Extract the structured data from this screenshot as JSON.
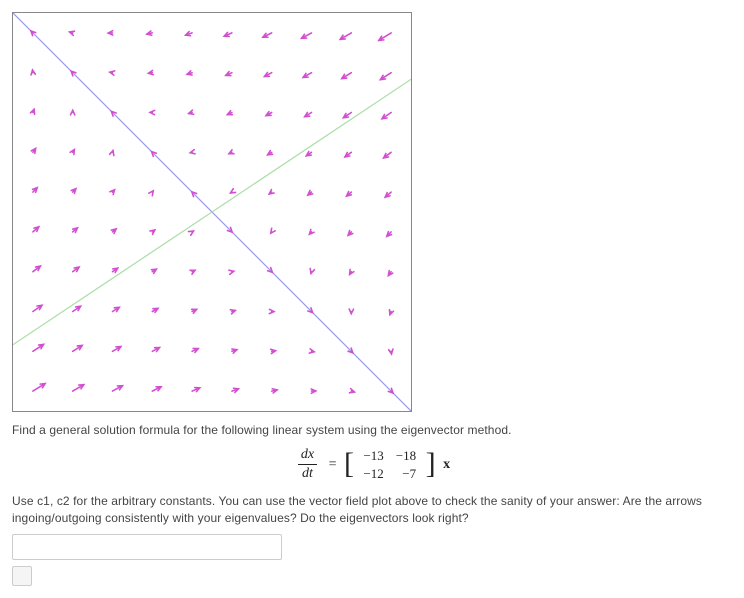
{
  "problem": {
    "prompt": "Find a general solution formula for the following linear system using the eigenvector method.",
    "equation": {
      "lhs_num": "dx",
      "lhs_den": "dt",
      "matrix": {
        "a11": "−13",
        "a12": "−18",
        "a21": "−12",
        "a22": "−7"
      },
      "vector": "x"
    },
    "hint": "Use c1, c2 for the arbitrary constants. You can use the vector field plot above to check the sanity of your answer: Are the arrows ingoing/outgoing consistently with your eigenvalues? Do the eigenvectors look right?"
  },
  "answer_value": "",
  "answer_placeholder": "",
  "chart_data": {
    "type": "vector-field",
    "title": "",
    "xlabel": "",
    "ylabel": "",
    "xlim": [
      -1,
      1
    ],
    "ylim": [
      -1,
      1
    ],
    "system_matrix": [
      [
        -13,
        -18
      ],
      [
        -12,
        -7
      ]
    ],
    "eigen_lines": [
      {
        "name": "eigenline-1",
        "slope": -1,
        "color": "#9a9ae8"
      },
      {
        "name": "eigenline-2",
        "slope": 0.6667,
        "color": "#a6dda6"
      }
    ],
    "grid_step": 0.2,
    "arrow_scale": 0.0022,
    "arrow_color": "#d24fd2",
    "annotations": []
  }
}
